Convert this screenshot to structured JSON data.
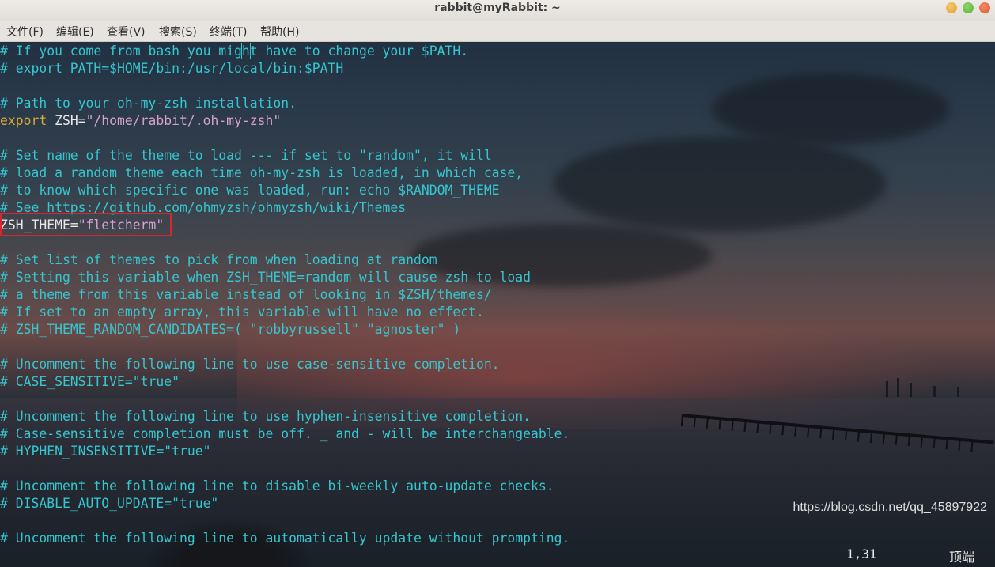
{
  "window": {
    "title": "rabbit@myRabbit: ~"
  },
  "menu": [
    "文件(F)",
    "编辑(E)",
    "查看(V)",
    "搜索(S)",
    "终端(T)",
    "帮助(H)"
  ],
  "editor": {
    "lines": [
      "# If you come from bash you might have to change your $PATH.",
      "# export PATH=$HOME/bin:/usr/local/bin:$PATH",
      "",
      "# Path to your oh-my-zsh installation.",
      "__EXPORT__",
      "",
      "# Set name of the theme to load --- if set to \"random\", it will",
      "# load a random theme each time oh-my-zsh is loaded, in which case,",
      "# to know which specific one was loaded, run: echo $RANDOM_THEME",
      "# See https://github.com/ohmyzsh/ohmyzsh/wiki/Themes",
      "__THEME__",
      "",
      "# Set list of themes to pick from when loading at random",
      "# Setting this variable when ZSH_THEME=random will cause zsh to load",
      "# a theme from this variable instead of looking in $ZSH/themes/",
      "# If set to an empty array, this variable will have no effect.",
      "# ZSH_THEME_RANDOM_CANDIDATES=( \"robbyrussell\" \"agnoster\" )",
      "",
      "# Uncomment the following line to use case-sensitive completion.",
      "# CASE_SENSITIVE=\"true\"",
      "",
      "# Uncomment the following line to use hyphen-insensitive completion.",
      "# Case-sensitive completion must be off. _ and - will be interchangeable.",
      "# HYPHEN_INSENSITIVE=\"true\"",
      "",
      "# Uncomment the following line to disable bi-weekly auto-update checks.",
      "# DISABLE_AUTO_UPDATE=\"true\"",
      "",
      "# Uncomment the following line to automatically update without prompting."
    ],
    "export_line": {
      "keyword": "export",
      "name": " ZSH=",
      "value": "\"/home/rabbit/.oh-my-zsh\""
    },
    "theme_line": {
      "name": "ZSH_THEME=",
      "value": "\"fletcherm\""
    },
    "status": {
      "position": "1,31",
      "location": "顶端"
    }
  },
  "watermark": "https://blog.csdn.net/qq_45897922",
  "colors": {
    "comment": "#35c6cf",
    "keyword": "#d6a83a",
    "string": "#d6a0cf",
    "highlight_box": "#d8262a"
  }
}
